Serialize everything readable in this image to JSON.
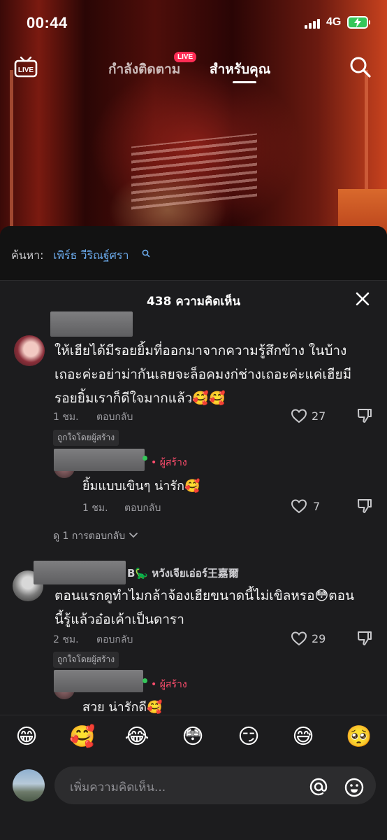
{
  "status_bar": {
    "time": "00:44",
    "network": "4G"
  },
  "nav": {
    "following_label": "กำลังติดตาม",
    "live_badge": "LIVE",
    "foryou_label": "สำหรับคุณ",
    "live_icon_text": "LIVE"
  },
  "search": {
    "prefix": "ค้นหา:",
    "term": "เพิร์ธ วีริณฐ์ศรา"
  },
  "comment_count": "438 ความคิดเห็น",
  "comments": [
    {
      "text_lines": [
        "ให้เฮียได้มีรอยยิ้มที่ออกมาจากความรู้สึกข้าง ในบ้าง",
        "เถอะค่ะอย่าม่ากันเลยจะล็อคมงก่ช่างเถอะค่ะแค่เฮียมี",
        "รอยยิ้มเราก็ดีใจมากแล้ว🥰🥰"
      ],
      "time": "1 ชม.",
      "reply_label": "ตอบกลับ",
      "likes": "27",
      "liked_by_creator": "ถูกใจโดยผู้สร้าง",
      "reply": {
        "creator_tag": "• ผู้สร้าง",
        "text": "ยิ้มแบบเขินๆ น่ารัก🥰",
        "time": "1 ชม.",
        "reply_label": "ตอบกลับ",
        "likes": "7"
      },
      "view_replies": "ดู 1 การตอบกลับ"
    },
    {
      "username_tail": "B🦕 หวังเจียเอ่อร์王嘉爾",
      "text_lines": [
        "ตอนแรกดูทำไมกล้าจ้องเฮียขนาดนี้ไม่เขิลหรอ😳ตอน",
        "นี้รู้แล้วอ๋อเค้าเป็นดารา"
      ],
      "time": "2 ชม.",
      "reply_label": "ตอบกลับ",
      "likes": "29",
      "liked_by_creator": "ถูกใจโดยผู้สร้าง",
      "reply": {
        "creator_tag": "• ผู้สร้าง",
        "text": "สวย น่ารักดี🥰"
      }
    }
  ],
  "emojis": [
    "😁",
    "🥰",
    "😂",
    "😳",
    "😏",
    "😅",
    "🥺"
  ],
  "input": {
    "placeholder": "เพิ่มความคิดเห็น..."
  },
  "colors": {
    "live_badge": "#ff2d55",
    "creator_tag": "#ff4d6d",
    "search_term": "#6aa8e8",
    "sheet_bg": "#1c1c1e"
  }
}
